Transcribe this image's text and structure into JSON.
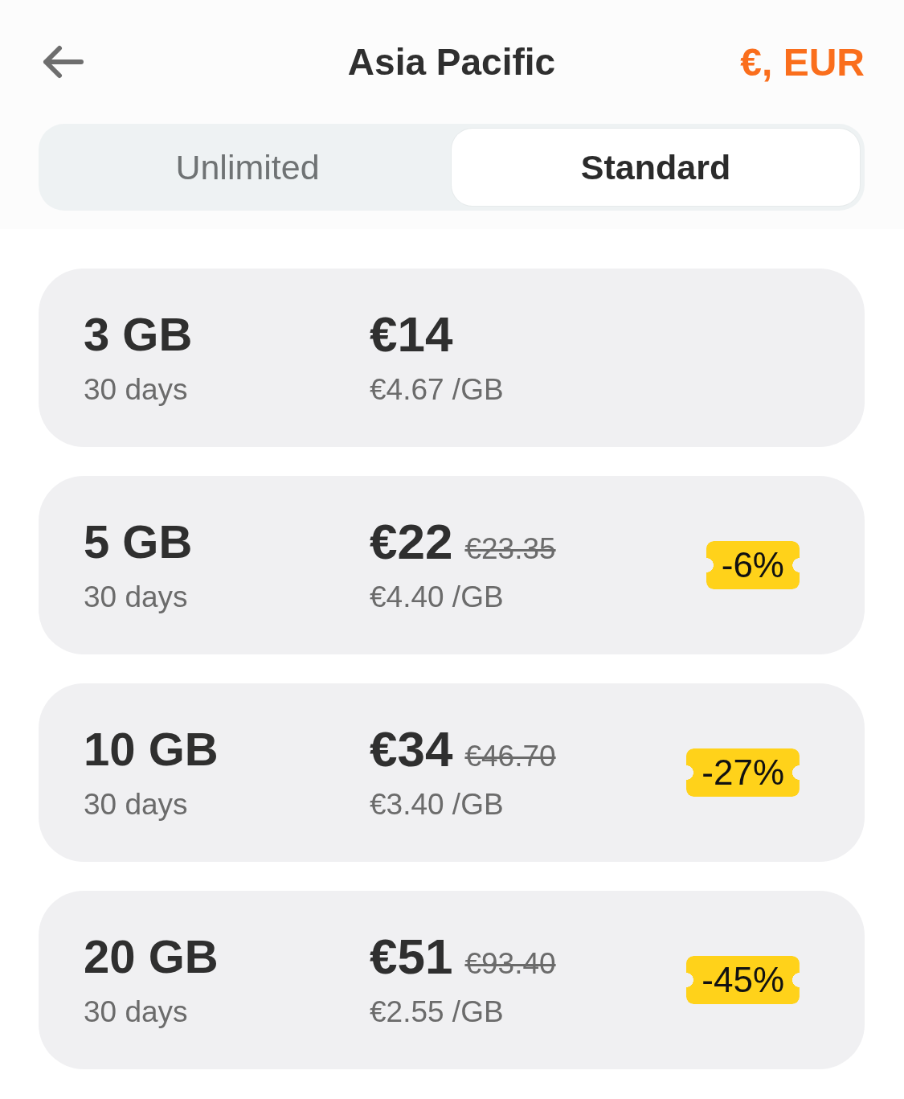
{
  "header": {
    "title": "Asia Pacific",
    "currency": "€, EUR"
  },
  "tabs": [
    {
      "label": "Unlimited",
      "selected": false
    },
    {
      "label": "Standard",
      "selected": true
    }
  ],
  "plans": [
    {
      "data": "3 GB",
      "duration": "30 days",
      "price": "€14",
      "per_gb": "€4.67 /GB"
    },
    {
      "data": "5 GB",
      "duration": "30 days",
      "price": "€22",
      "old_price": "€23.35",
      "per_gb": "€4.40 /GB",
      "discount": "-6%"
    },
    {
      "data": "10 GB",
      "duration": "30 days",
      "price": "€34",
      "old_price": "€46.70",
      "per_gb": "€3.40 /GB",
      "discount": "-27%"
    },
    {
      "data": "20 GB",
      "duration": "30 days",
      "price": "€51",
      "old_price": "€93.40",
      "per_gb": "€2.55 /GB",
      "discount": "-45%"
    }
  ]
}
